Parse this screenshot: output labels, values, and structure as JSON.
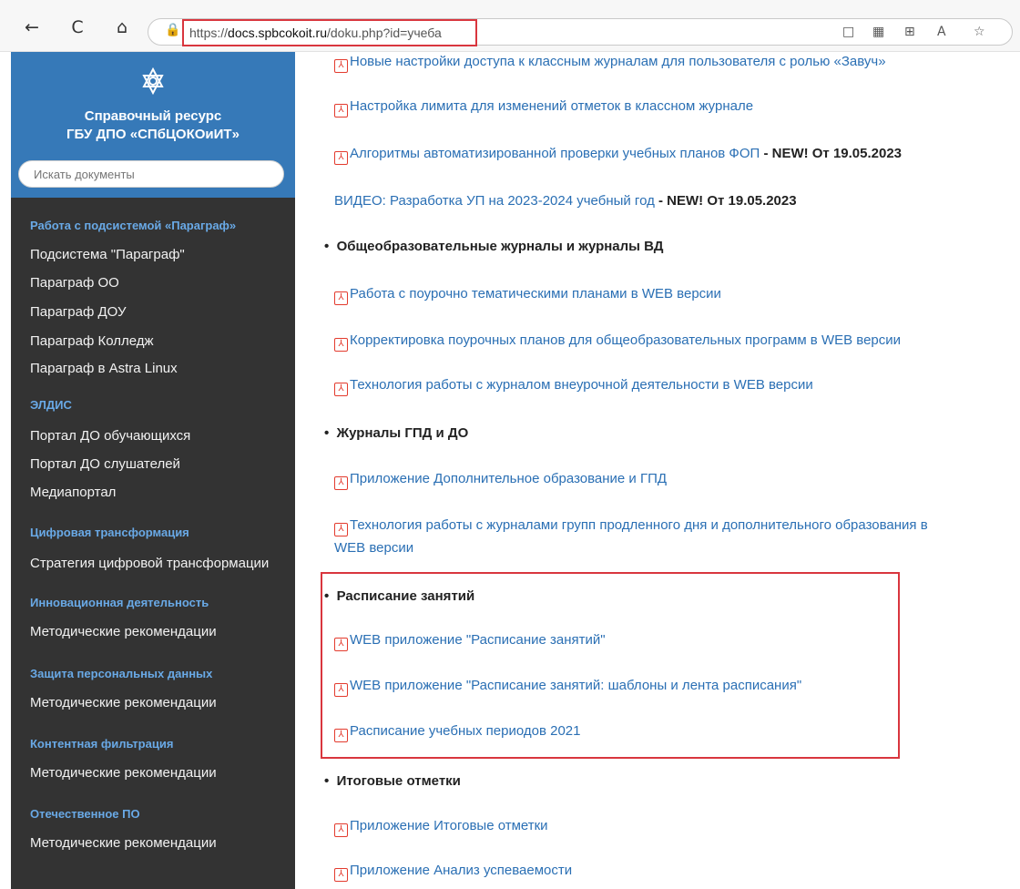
{
  "browser": {
    "back_glyph": "←",
    "refresh_glyph": "C",
    "home_glyph": "⌂",
    "lock_glyph": "🔒",
    "url_scheme": "https://",
    "url_host": "docs.spbcokoit.ru",
    "url_path": "/doku.php?id=учеба",
    "right_icons": [
      "□",
      "▦",
      "⊞",
      "A",
      "☆"
    ]
  },
  "sidebar": {
    "brand_line1": "Справочный ресурс",
    "brand_line2": "ГБУ ДПО «СПбЦОКОиИТ»",
    "search_placeholder": "Искать документы",
    "sections": [
      {
        "title": "Работа с подсистемой «Параграф»",
        "items": [
          "Подсистема \"Параграф\"",
          "Параграф ОО",
          "Параграф ДОУ",
          "Параграф Колледж",
          "Параграф в Astra Linux"
        ]
      },
      {
        "title": "ЭЛДИС",
        "items": [
          "Портал ДО обучающихся",
          "Портал ДО слушателей",
          "Медиапортал"
        ]
      },
      {
        "title": "Цифровая трансформация",
        "items": [
          "Стратегия цифровой трансформации"
        ]
      },
      {
        "title": "Инновационная деятельность",
        "items": [
          "Методические рекомендации"
        ]
      },
      {
        "title": "Защита персональных данных",
        "items": [
          "Методические рекомендации"
        ]
      },
      {
        "title": "Контентная фильтрация",
        "items": [
          "Методические рекомендации"
        ]
      },
      {
        "title": "Отечественное ПО",
        "items": [
          "Методические рекомендации"
        ]
      }
    ]
  },
  "content": {
    "links": [
      "Новые настройки доступа к классным журналам для пользователя с ролью «Завуч»",
      "Настройка лимита для изменений отметок в классном журнале",
      "Алгоритмы автоматизированной проверки учебных планов ФОП",
      "ВИДЕО: Разработка УП на 2023-2024 учебный год",
      "Работа с поурочно тематическими планами в WEB версии",
      "Корректировка поурочных планов для общеобразовательных программ в WEB версии",
      "Технология работы с журналом внеурочной деятельности в WEB версии",
      "Приложение Дополнительное образование и ГПД",
      "Технология работы с журналами групп продленного дня и дополнительного образования в",
      "WEB версии",
      "WEB приложение \"Расписание занятий\"",
      "WEB приложение \"Расписание занятий: шаблоны и лента расписания\"",
      "Расписание учебных периодов 2021",
      "Приложение Итоговые отметки",
      "Приложение Анализ успеваемости"
    ],
    "new_badge": " - NEW! От 19.05.2023",
    "bullets": [
      "Общеобразовательные журналы и журналы ВД",
      "Журналы ГПД и ДО",
      "Расписание занятий",
      "Итоговые отметки"
    ],
    "pdf_glyph": "⅄"
  },
  "colors": {
    "sidebar_bg": "#333333",
    "brand_bg": "#3679b8",
    "section_title": "#69a9e6",
    "link": "#2a6fb4",
    "highlight": "#d9363e",
    "pdf_icon": "#e33b2e"
  }
}
